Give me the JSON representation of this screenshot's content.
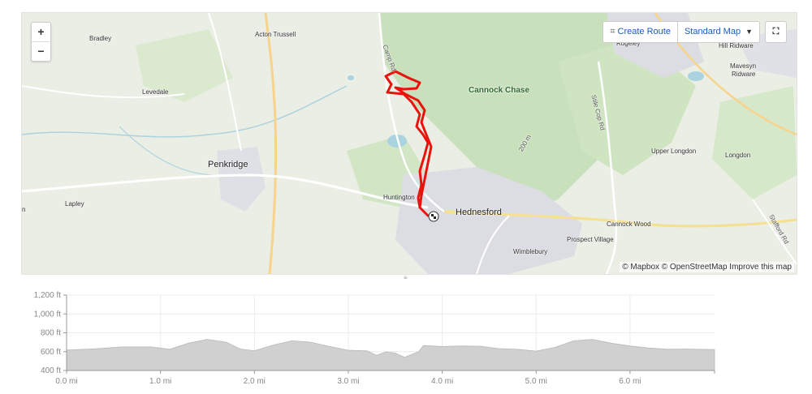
{
  "map": {
    "zoom_in": "+",
    "zoom_out": "−",
    "create_route": "Create Route",
    "map_style": "Standard Map",
    "attribution": "© Mapbox © OpenStreetMap Improve this map",
    "places": {
      "bradley": "Bradley",
      "acton_trussell": "Acton Trussell",
      "camp_rd": "Camp Rd",
      "rugeley": "Rugeley",
      "hill_ridware": "Hill Ridware",
      "mavesyn_ridware_1": "Mavesyn",
      "mavesyn_ridware_2": "Ridware",
      "levedale": "Levedale",
      "cannock_chase": "Cannock Chase",
      "stile_cop_rd": "Stile Cop Rd",
      "contour_200m": "200 m",
      "upper_longdon": "Upper Longdon",
      "longdon": "Longdon",
      "penkridge": "Penkridge",
      "huntington": "Huntington",
      "hednesford": "Hednesford",
      "lapley": "Lapley",
      "cannock_wood": "Cannock Wood",
      "stafford_rd": "Stafford Rd",
      "prospect_village": "Prospect Village",
      "wimblebury": "Wimblebury",
      "edge_n": "n"
    },
    "colors": {
      "route": "#e8130d",
      "woodland": "#c9e0bd",
      "urban": "#dcdde3",
      "water": "#aad3df"
    }
  },
  "chart_data": {
    "type": "area",
    "xlabel": "",
    "ylabel": "",
    "x_ticks": [
      "0.0 mi",
      "1.0 mi",
      "2.0 mi",
      "3.0 mi",
      "4.0 mi",
      "5.0 mi",
      "6.0 mi"
    ],
    "y_ticks": [
      "400 ft",
      "600 ft",
      "800 ft",
      "1,000 ft",
      "1,200 ft"
    ],
    "xlim": [
      0,
      6.9
    ],
    "ylim": [
      400,
      1200
    ],
    "grid": true,
    "fill_color": "#d0d0d0",
    "series": [
      {
        "x": [
          0,
          0.3,
          0.6,
          0.9,
          1.1,
          1.3,
          1.5,
          1.7,
          1.85,
          2.0,
          2.2,
          2.4,
          2.6,
          2.8,
          3.0,
          3.2,
          3.3,
          3.4,
          3.5,
          3.6,
          3.75,
          3.8,
          4.0,
          4.2,
          4.4,
          4.6,
          4.8,
          5.0,
          5.2,
          5.4,
          5.6,
          5.8,
          6.0,
          6.2,
          6.4,
          6.6,
          6.9
        ],
        "y": [
          618,
          630,
          650,
          650,
          625,
          690,
          730,
          700,
          628,
          610,
          670,
          715,
          700,
          655,
          615,
          608,
          560,
          598,
          585,
          540,
          600,
          665,
          655,
          660,
          658,
          632,
          625,
          605,
          645,
          715,
          730,
          690,
          660,
          638,
          625,
          628,
          622
        ]
      }
    ]
  }
}
